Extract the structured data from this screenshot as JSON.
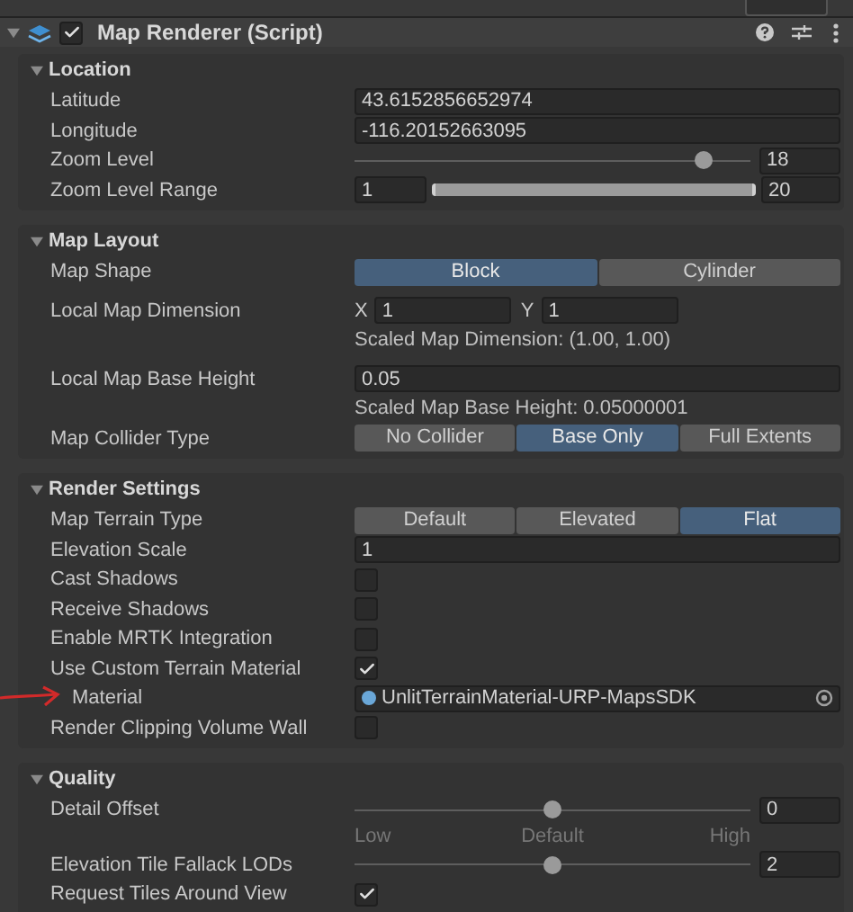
{
  "component": {
    "title": "Map Renderer (Script)",
    "enabled": true,
    "expanded": true
  },
  "sections": [
    {
      "title": "Location",
      "expanded": true,
      "rows": [
        {
          "kind": "text",
          "label": "Latitude",
          "value": "43.6152856652974"
        },
        {
          "kind": "text",
          "label": "Longitude",
          "value": "-116.20152663095"
        },
        {
          "kind": "slider",
          "label": "Zoom Level",
          "level": 0.88,
          "value": "18"
        },
        {
          "kind": "range",
          "label": "Zoom Level Range",
          "min": "1",
          "max": "20"
        }
      ]
    },
    {
      "title": "Map Layout",
      "expanded": true,
      "rows": [
        {
          "kind": "toggle",
          "label": "Map Shape",
          "options": [
            {
              "label": "Block",
              "selected": true
            },
            {
              "label": "Cylinder",
              "selected": false
            }
          ]
        },
        {
          "kind": "vector2",
          "label": "Local Map Dimension",
          "fields": [
            {
              "axis": "X",
              "value": "1"
            },
            {
              "axis": "Y",
              "value": "1"
            }
          ],
          "note": "Scaled Map Dimension: (1.00, 1.00)"
        },
        {
          "kind": "text",
          "label": "Local Map Base Height",
          "value": "0.05",
          "note": "Scaled Map Base Height: 0.05000001"
        },
        {
          "kind": "toggle",
          "label": "Map Collider Type",
          "options": [
            {
              "label": "No Collider",
              "selected": false
            },
            {
              "label": "Base Only",
              "selected": true
            },
            {
              "label": "Full Extents",
              "selected": false
            }
          ]
        }
      ]
    },
    {
      "title": "Render Settings",
      "expanded": true,
      "rows": [
        {
          "kind": "toggle",
          "label": "Map Terrain Type",
          "options": [
            {
              "label": "Default",
              "selected": false
            },
            {
              "label": "Elevated",
              "selected": false
            },
            {
              "label": "Flat",
              "selected": true
            }
          ]
        },
        {
          "kind": "text",
          "label": "Elevation Scale",
          "value": "1"
        },
        {
          "kind": "checkbox",
          "label": "Cast Shadows",
          "checked": false
        },
        {
          "kind": "checkbox",
          "label": "Receive Shadows",
          "checked": false
        },
        {
          "kind": "checkbox",
          "label": "Enable MRTK Integration",
          "checked": false
        },
        {
          "kind": "checkbox",
          "label": "Use Custom Terrain Material",
          "checked": true,
          "children": [
            {
              "kind": "object",
              "label": "Material",
              "value": "UnlitTerrainMaterial-URP-MapsSDK",
              "annotated": true
            }
          ]
        },
        {
          "kind": "checkbox",
          "label": "Render Clipping Volume Wall",
          "checked": false
        }
      ]
    },
    {
      "title": "Quality",
      "expanded": true,
      "rows": [
        {
          "kind": "slider",
          "label": "Detail Offset",
          "level": 0.5,
          "value": "0",
          "ticks": [
            "Low",
            "Default",
            "High"
          ]
        },
        {
          "kind": "slider",
          "label": "Elevation Tile Fallack LODs",
          "level": 0.5,
          "value": "2"
        },
        {
          "kind": "checkbox",
          "label": "Request Tiles Around View",
          "checked": true
        }
      ]
    }
  ]
}
